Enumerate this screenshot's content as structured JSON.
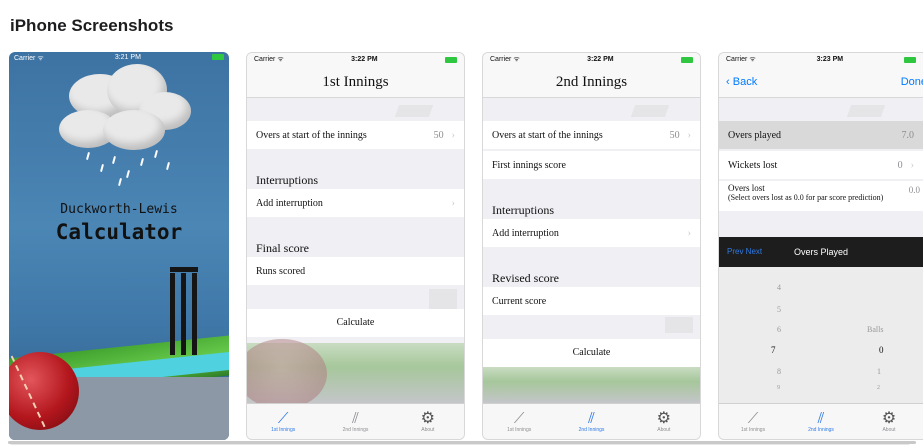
{
  "section_title": "iPhone Screenshots",
  "colors": {
    "ios_blue": "#2f7ae5",
    "splash_blue": "#4b86b5",
    "battery_green": "#2ec73f"
  },
  "screens": [
    {
      "status": {
        "carrier": "Carrier ᯤ",
        "time": "3:21 PM"
      },
      "title_line1": "Duckworth-Lewis",
      "title_line2": "Calculator"
    },
    {
      "status": {
        "carrier": "Carrier ᯤ",
        "time": "3:22 PM"
      },
      "nav_title": "1st Innings",
      "overs_label": "Overs at start of the innings",
      "overs_value": "50",
      "interruptions_header": "Interruptions",
      "add_interruption": "Add interruption",
      "final_score_header": "Final score",
      "runs_scored": "Runs scored",
      "calculate": "Calculate",
      "tabs": [
        {
          "label": "1st Innings",
          "icon": "bat-icon"
        },
        {
          "label": "2nd Innings",
          "icon": "bats-icon"
        },
        {
          "label": "About",
          "icon": "gear-icon"
        }
      ]
    },
    {
      "status": {
        "carrier": "Carrier ᯤ",
        "time": "3:22 PM"
      },
      "nav_title": "2nd Innings",
      "overs_label": "Overs at start of the innings",
      "overs_value": "50",
      "first_innings_score": "First innings score",
      "interruptions_header": "Interruptions",
      "add_interruption": "Add interruption",
      "revised_score_header": "Revised score",
      "current_score": "Current score",
      "calculate": "Calculate",
      "tabs": [
        {
          "label": "1st Innings",
          "icon": "bat-icon"
        },
        {
          "label": "2nd Innings",
          "icon": "bats-icon"
        },
        {
          "label": "About",
          "icon": "gear-icon"
        }
      ]
    },
    {
      "status": {
        "carrier": "Carrier ᯤ",
        "time": "3:23 PM"
      },
      "back_label": "Back",
      "done_label": "Done",
      "overs_played_label": "Overs played",
      "overs_played_value": "7.0",
      "wickets_lost_label": "Wickets lost",
      "wickets_lost_value": "0",
      "overs_lost_label": "Overs lost",
      "overs_lost_sub": "(Select overs lost as 0.0 for par score prediction)",
      "overs_lost_value": "0.0",
      "toolbar_prevnext": "Prev  Next",
      "toolbar_title": "Overs Played",
      "picker_overs": [
        "4",
        "5",
        "6",
        "7",
        "8",
        "9"
      ],
      "picker_balls_label": "Balls",
      "picker_balls": [
        "0",
        "1",
        "2"
      ],
      "tabs": [
        {
          "label": "1st Innings",
          "icon": "bat-icon"
        },
        {
          "label": "2nd Innings",
          "icon": "bats-icon"
        },
        {
          "label": "About",
          "icon": "gear-icon"
        }
      ]
    }
  ]
}
